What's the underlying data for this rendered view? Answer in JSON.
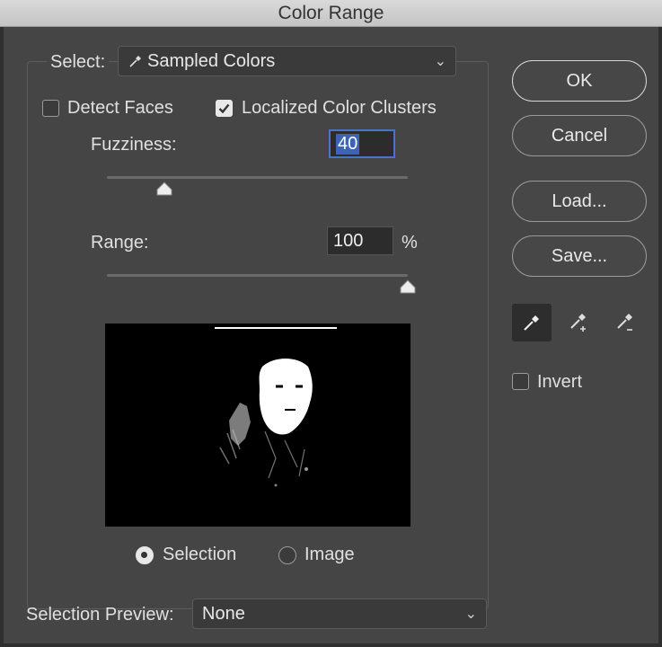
{
  "window": {
    "title": "Color Range"
  },
  "select": {
    "label": "Select:",
    "value": "Sampled Colors"
  },
  "options": {
    "detect_faces": "Detect Faces",
    "localized_clusters": "Localized Color Clusters"
  },
  "fuzziness": {
    "label": "Fuzziness:",
    "value": "40",
    "level": 0.19
  },
  "range": {
    "label": "Range:",
    "value": "100",
    "unit": "%",
    "level": 1.0
  },
  "preview_mode": {
    "selection": "Selection",
    "image": "Image"
  },
  "selection_preview": {
    "label": "Selection Preview:",
    "value": "None"
  },
  "buttons": {
    "ok": "OK",
    "cancel": "Cancel",
    "load": "Load...",
    "save": "Save..."
  },
  "tools": [
    "eyedropper-icon",
    "eyedropper-add-icon",
    "eyedropper-subtract-icon"
  ],
  "invert": {
    "label": "Invert"
  }
}
